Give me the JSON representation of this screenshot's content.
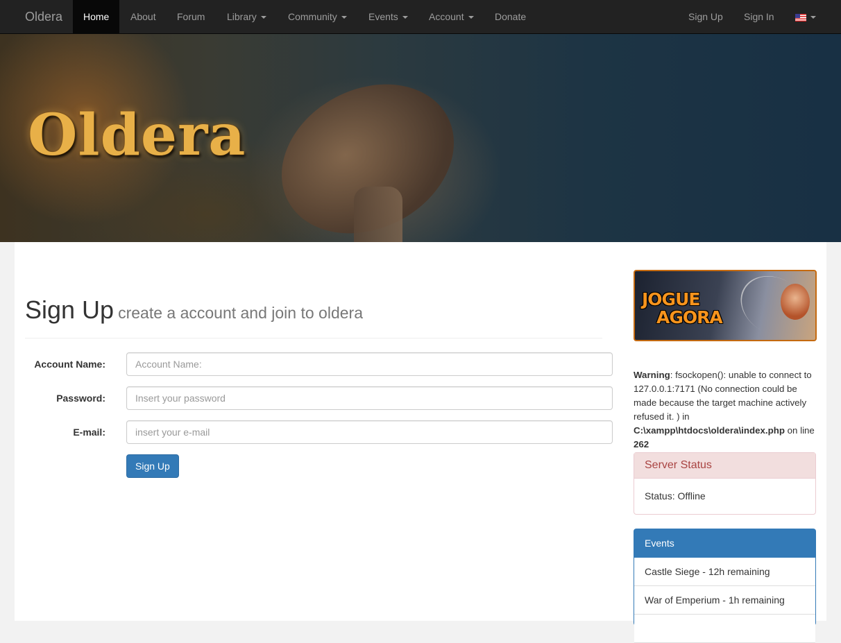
{
  "navbar": {
    "brand": "Oldera",
    "items": [
      {
        "label": "Home"
      },
      {
        "label": "About"
      },
      {
        "label": "Forum"
      },
      {
        "label": "Library"
      },
      {
        "label": "Community"
      },
      {
        "label": "Events"
      },
      {
        "label": "Account"
      },
      {
        "label": "Donate"
      }
    ],
    "right": {
      "signup": "Sign Up",
      "signin": "Sign In",
      "language_icon": "us-flag-icon"
    }
  },
  "banner": {
    "logo_text": "Oldera"
  },
  "page": {
    "title": "Sign Up",
    "subtitle": "create a account and join to oldera"
  },
  "form": {
    "account_label": "Account Name:",
    "account_placeholder": "Account Name:",
    "password_label": "Password:",
    "password_placeholder": "Insert your password",
    "email_label": "E-mail:",
    "email_placeholder": "insert your e-mail",
    "submit_label": "Sign Up"
  },
  "sidebar": {
    "promo": {
      "line1": "JOGUE",
      "line2": "AGORA"
    },
    "warning": {
      "label": "Warning",
      "text1": ": fsockopen(): unable to connect to 127.0.0.1:7171 (No connection could be made because the target machine actively refused it. ) in ",
      "path": "C:\\xampp\\htdocs\\oldera\\index.php",
      "text2": " on line ",
      "line": "262"
    },
    "server_status": {
      "title": "Server Status",
      "status": "Status: Offline"
    },
    "events": {
      "title": "Events",
      "items": [
        "Castle Siege - 12h remaining",
        "War of Emperium - 1h remaining"
      ]
    }
  },
  "colors": {
    "primary": "#337ab7",
    "danger_bg": "#f2dede",
    "navbar": "#222222",
    "promo_border": "#c56a10"
  }
}
